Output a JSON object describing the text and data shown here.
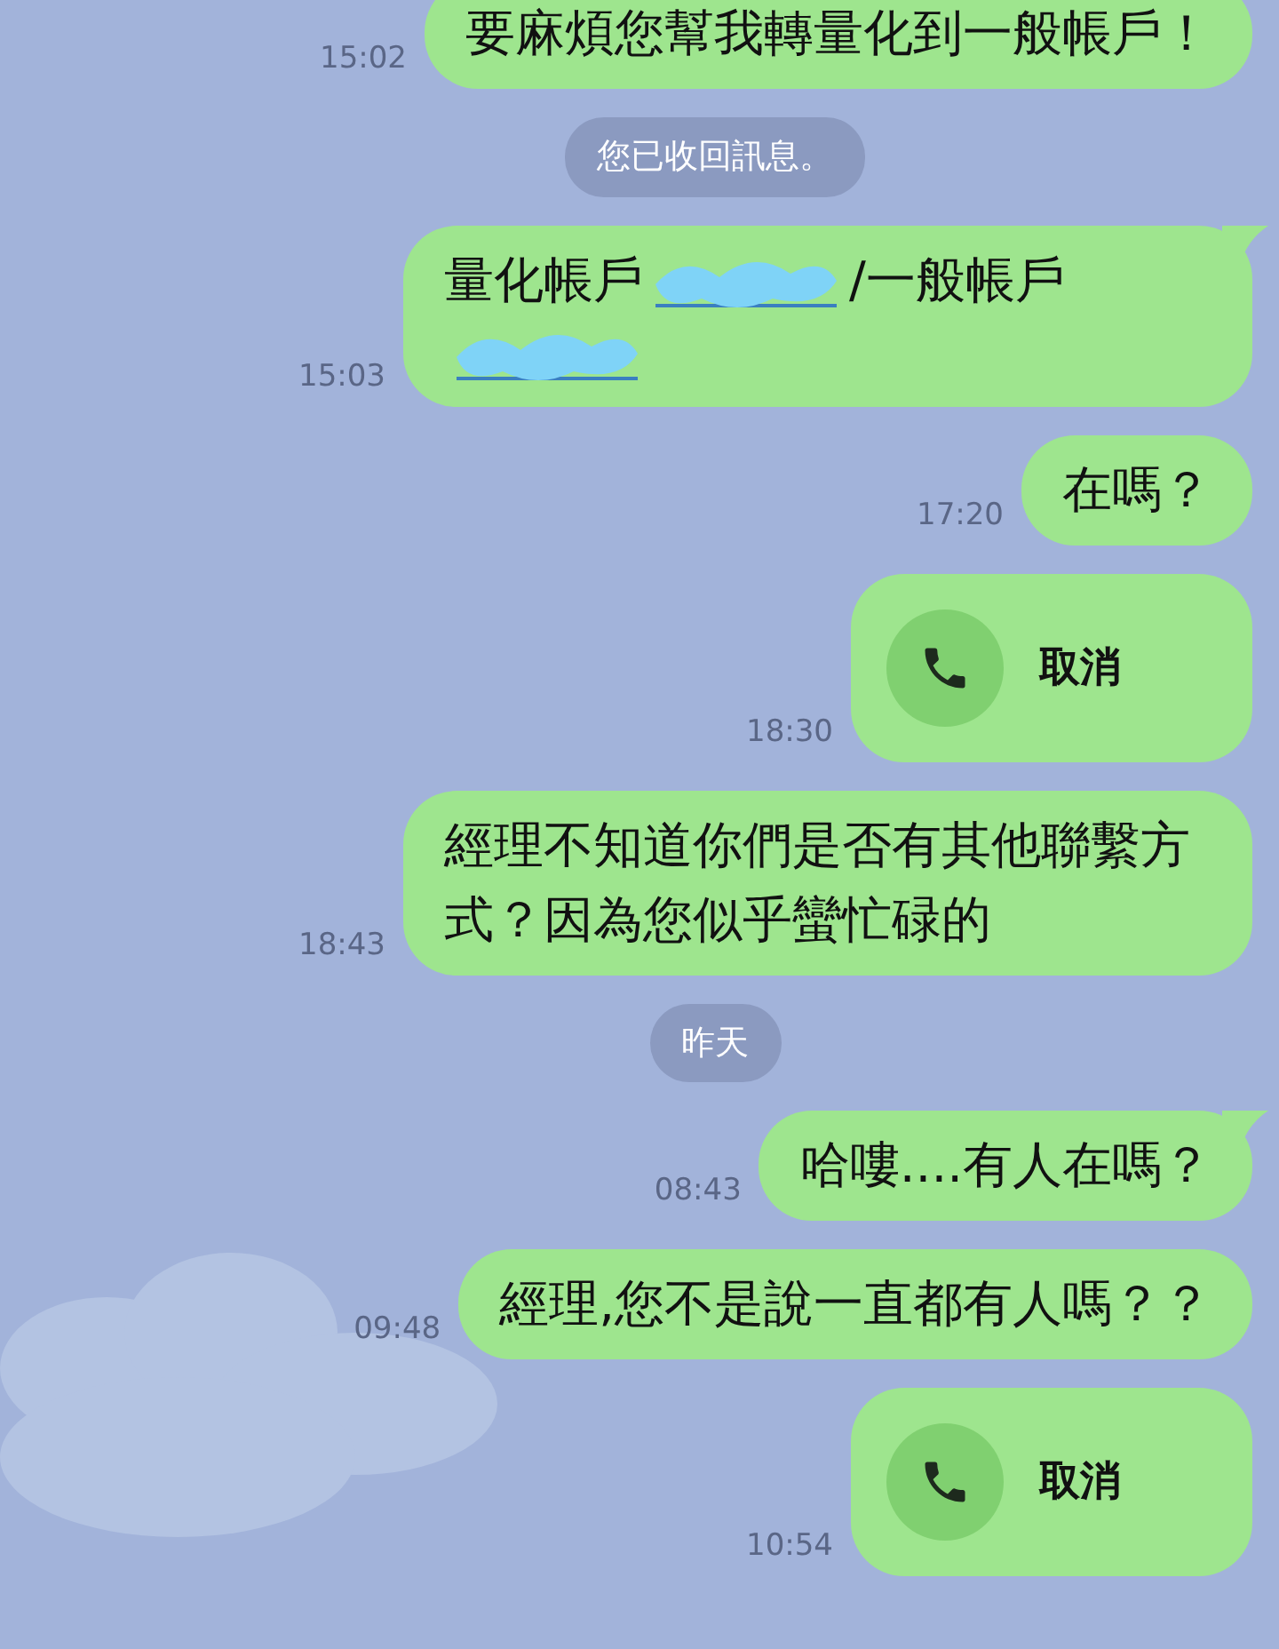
{
  "messages": [
    {
      "kind": "text",
      "text": "要麻煩您幫我轉量化到一般帳戶！",
      "time": "15:02",
      "tail": false
    },
    {
      "kind": "notice",
      "text": "您已收回訊息。"
    },
    {
      "kind": "redacted",
      "before": "量化帳戶",
      "after": "/一般帳戶",
      "time": "15:03",
      "tail": true
    },
    {
      "kind": "text",
      "text": "在嗎？",
      "time": "17:20",
      "tail": false
    },
    {
      "kind": "call",
      "text": "取消",
      "time": "18:30",
      "tail": false
    },
    {
      "kind": "text",
      "text": "經理不知道你們是否有其他聯繫方式？因為您似乎蠻忙碌的",
      "time": "18:43",
      "tail": false
    },
    {
      "kind": "notice",
      "text": "昨天"
    },
    {
      "kind": "text",
      "text": "哈嘍....有人在嗎？",
      "time": "08:43",
      "tail": true
    },
    {
      "kind": "text",
      "text": "經理,您不是說一直都有人嗎？？",
      "time": "09:48",
      "tail": false
    },
    {
      "kind": "call",
      "text": "取消",
      "time": "10:54",
      "tail": false
    }
  ]
}
